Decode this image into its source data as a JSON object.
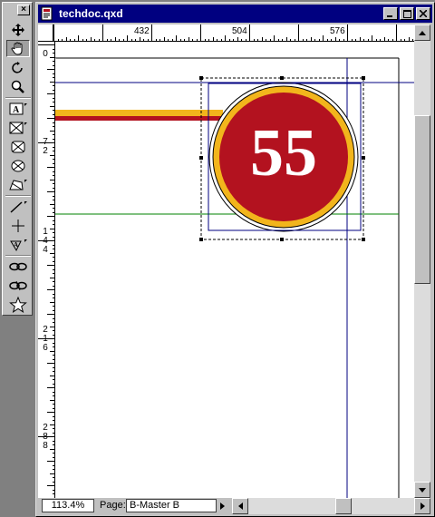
{
  "window": {
    "title": "techdoc.qxd",
    "minimize_label": "_",
    "maximize_label": "□",
    "close_label": "×"
  },
  "palette": {
    "close_label": "×",
    "tools": [
      {
        "name": "item-tool",
        "icon": "move-arrows-icon"
      },
      {
        "name": "content-tool",
        "icon": "hand-icon"
      },
      {
        "name": "rotation-tool",
        "icon": "rotate-icon"
      },
      {
        "name": "zoom-tool",
        "icon": "magnifier-icon"
      },
      {
        "name": "text-box-tool",
        "icon": "text-box-icon"
      },
      {
        "name": "rectangle-picture-box-tool",
        "icon": "rect-picture-box-icon"
      },
      {
        "name": "rounded-picture-box-tool",
        "icon": "rounded-picture-box-icon"
      },
      {
        "name": "oval-picture-box-tool",
        "icon": "oval-picture-box-icon"
      },
      {
        "name": "bezier-picture-box-tool",
        "icon": "bezier-picture-box-icon"
      },
      {
        "name": "line-tool",
        "icon": "line-icon"
      },
      {
        "name": "orthogonal-line-tool",
        "icon": "orthogonal-line-icon"
      },
      {
        "name": "text-path-tool",
        "icon": "text-path-icon"
      },
      {
        "name": "linking-tool",
        "icon": "link-icon"
      },
      {
        "name": "unlinking-tool",
        "icon": "unlink-icon"
      },
      {
        "name": "starburst-tool",
        "icon": "star-icon"
      }
    ]
  },
  "rulers": {
    "horizontal_labels": [
      "432",
      "504",
      "576"
    ],
    "vertical_labels": [
      "0",
      "7\n2",
      "1\n4\n4",
      "2\n1\n6",
      "2\n8\n8"
    ]
  },
  "artwork": {
    "badge_number": "55",
    "colors": {
      "badge_red": "#b3121f",
      "badge_ring": "#f2b51c",
      "stripe_yellow": "#f2b51c",
      "stripe_red": "#b3121f",
      "guide_blue": "#000080",
      "guide_green": "#008000"
    }
  },
  "status": {
    "zoom": "113.4%",
    "page_label": "Page:",
    "page_value": "B-Master B"
  }
}
